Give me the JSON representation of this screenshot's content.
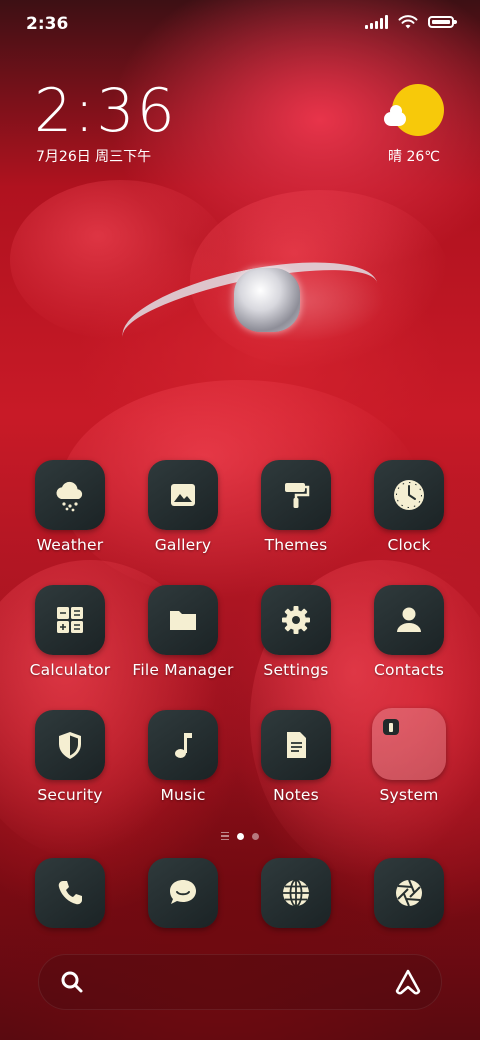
{
  "status_bar": {
    "time": "2:36"
  },
  "clock_widget": {
    "time": "2:36",
    "date": "7月26日 周三下午"
  },
  "weather_widget": {
    "condition_temp": "晴 26℃",
    "sun_color": "#f7c90a"
  },
  "apps": [
    {
      "label": "Weather"
    },
    {
      "label": "Gallery"
    },
    {
      "label": "Themes"
    },
    {
      "label": "Clock"
    },
    {
      "label": "Calculator"
    },
    {
      "label": "File Manager"
    },
    {
      "label": "Settings"
    },
    {
      "label": "Contacts"
    },
    {
      "label": "Security"
    },
    {
      "label": "Music"
    },
    {
      "label": "Notes"
    },
    {
      "label": "System"
    }
  ],
  "dock": [
    {
      "icon": "phone-icon"
    },
    {
      "icon": "messages-icon"
    },
    {
      "icon": "browser-icon"
    },
    {
      "icon": "camera-icon"
    }
  ],
  "page_indicator": {
    "pages": 2,
    "active_page": 1
  },
  "colors": {
    "icon_bg": "#27302f",
    "glyph": "#f5efd2",
    "wallpaper_red": "#c81a27"
  }
}
